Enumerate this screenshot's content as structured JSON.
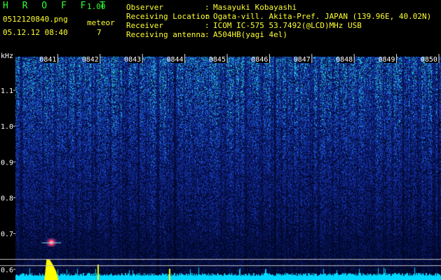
{
  "header": {
    "app_title": "H R O F F T",
    "app_version": "1.00",
    "file_name": "0512120840.png",
    "date_time": "05.12.12 08:40",
    "meteor_label": "meteor",
    "meteor_count": "7",
    "info": [
      {
        "label": "Observer",
        "value": "Masayuki Kobayashi"
      },
      {
        "label": "Receiving Location",
        "value": "Ogata-vill. Akita-Pref. JAPAN (139.96E, 40.02N)"
      },
      {
        "label": "Receiver",
        "value": "ICOM IC-575 53.7492(@LCD)MHz USB"
      },
      {
        "label": "Receiving antenna",
        "value": "A504HB(yagi 4el)"
      }
    ],
    "colon": ":"
  },
  "colors": {
    "header_text_green": "#33ff33",
    "header_text_yellow": "#ffff33",
    "axis_text": "#ffffff",
    "time_label_bg": "#000000",
    "spectrum_cyan": "#00d8ff",
    "meteor_echo_red": "#ff3355",
    "baseline_yellow": "#ffff00",
    "noise_blue": "#1838a8"
  },
  "chart_data": {
    "type": "heatmap",
    "ylabel": "kHz",
    "y_ticks": [
      "1.1",
      "1.0",
      "0.9",
      "0.8",
      "0.7",
      "0.6"
    ],
    "y_tick_values": [
      1.1,
      1.0,
      0.9,
      0.8,
      0.7,
      0.6
    ],
    "ylim": [
      0.58,
      1.19
    ],
    "x_ticks": [
      "0841",
      "0842",
      "0843",
      "0844",
      "0845",
      "0846",
      "0847",
      "0848",
      "0849",
      "0850"
    ],
    "x_tick_minutes": [
      1,
      2,
      3,
      4,
      5,
      6,
      7,
      8,
      9,
      10
    ],
    "xlim_minutes": [
      0,
      10.05
    ],
    "meteor_echoes": [
      {
        "minute": 0.85,
        "khz": 0.675,
        "strength": "strong"
      }
    ]
  }
}
